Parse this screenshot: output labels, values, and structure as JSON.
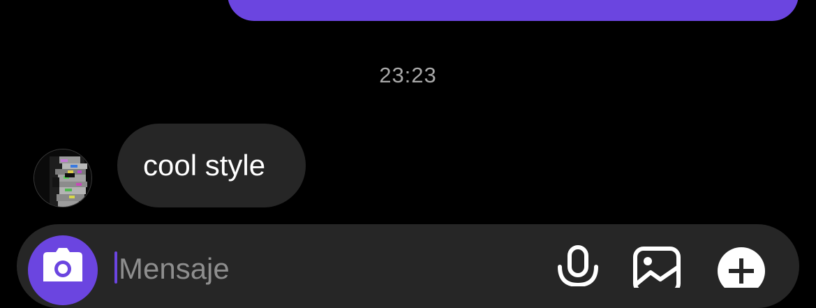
{
  "thread": {
    "timestamp": "23:23",
    "received_message": {
      "text": "cool style"
    }
  },
  "composer": {
    "placeholder": "Mensaje",
    "value": ""
  },
  "icons": {
    "camera": "camera-icon",
    "microphone": "microphone-icon",
    "gallery": "image-gallery-icon",
    "add": "plus-icon"
  },
  "colors": {
    "accent": "#6b45e0",
    "bubble_received": "#262626",
    "background": "#000000",
    "timestamp": "#a8a8a8"
  }
}
